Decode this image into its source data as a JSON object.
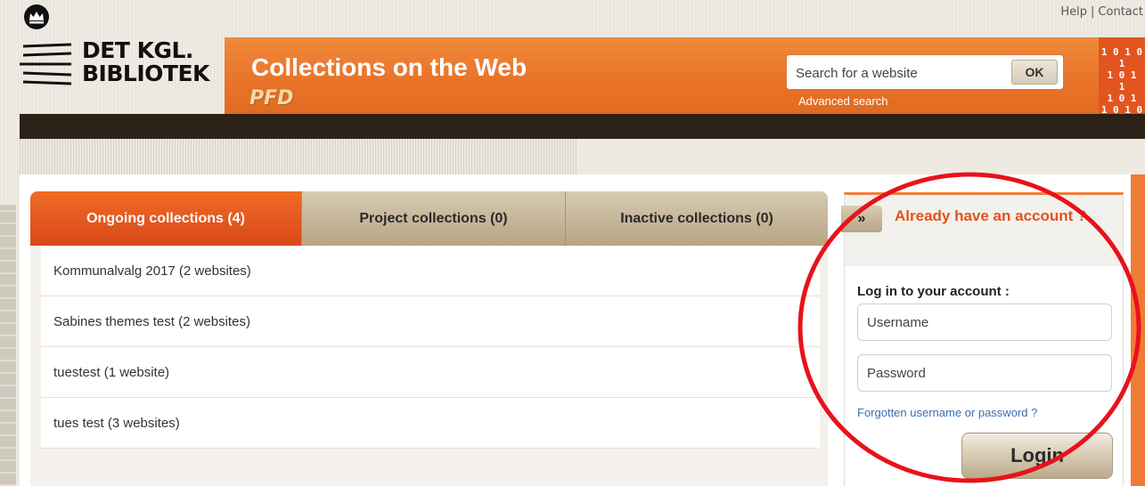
{
  "top_links": {
    "help": "Help",
    "separator": "|",
    "contact": "Contact"
  },
  "logo": {
    "line1": "DET KGL.",
    "line2": "BIBLIOTEK"
  },
  "banner": {
    "title": "Collections on the Web",
    "subtitle": "PFD",
    "search_placeholder": "Search for a website",
    "ok_label": "OK",
    "advanced_search": "Advanced search",
    "binary_icon": [
      "1 0 1 0 1",
      "1 0 1",
      "1",
      "1 0 1",
      "1 0 1 0 1"
    ]
  },
  "tabs": [
    {
      "label": "Ongoing collections (4)",
      "active": true
    },
    {
      "label": "Project collections (0)",
      "active": false
    },
    {
      "label": "Inactive collections (0)",
      "active": false
    }
  ],
  "collections": [
    {
      "label": "Kommunalvalg 2017 (2 websites)"
    },
    {
      "label": "Sabines themes test (2 websites)"
    },
    {
      "label": "tuestest (1 website)"
    },
    {
      "label": "tues test (3 websites)"
    }
  ],
  "login": {
    "expand_label": "»",
    "title": "Already have an account ?",
    "subhead": "Log in to your account :",
    "username_placeholder": "Username",
    "password_placeholder": "Password",
    "forgot_link": "Forgotten username or password ?",
    "login_button": "Login"
  },
  "colors": {
    "accent_orange": "#e9742a",
    "active_tab": "#e05a1f",
    "annotation_red": "#e8121b",
    "dark_bar": "#2c2116"
  }
}
